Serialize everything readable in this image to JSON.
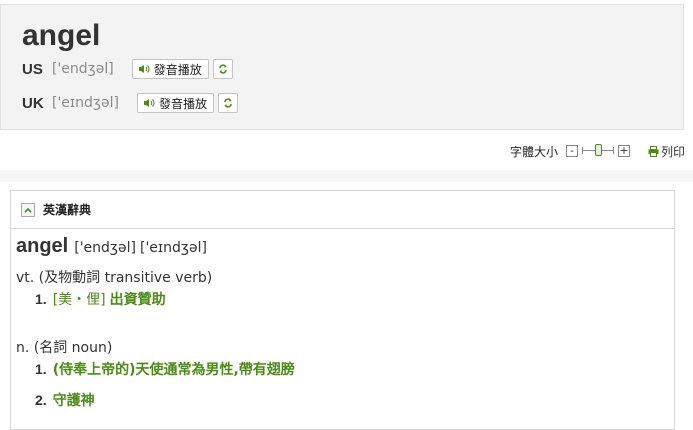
{
  "headword": {
    "word": "angel",
    "pronunciations": [
      {
        "region": "US",
        "ipa": "['endʒəl]",
        "play_label": "發音播放"
      },
      {
        "region": "UK",
        "ipa": "['eɪndʒəl]",
        "play_label": "發音播放"
      }
    ]
  },
  "toolbar": {
    "font_size_label": "字體大小",
    "decrease": "-",
    "increase": "+",
    "print_label": "列印"
  },
  "dictionary": {
    "title": "英漢辭典",
    "word": "angel",
    "ipa_us": "['endʒəl]",
    "ipa_uk": "['eɪndʒəl]",
    "parts": [
      {
        "pos": "vt. (及物動詞 transitive verb)",
        "senses": [
          {
            "num": "1.",
            "region": "[美・俚]",
            "text": "出資贊助"
          }
        ]
      },
      {
        "pos": "n. (名詞 noun)",
        "senses": [
          {
            "num": "1.",
            "text": "(侍奉上帝的)天使通常為男性,帶有翅膀"
          },
          {
            "num": "2.",
            "text": "守護神"
          }
        ]
      }
    ]
  },
  "colors": {
    "accent_green": "#4e8a1a",
    "header_bg": "#f3f3f3",
    "text_gray": "#8a8a8a"
  }
}
